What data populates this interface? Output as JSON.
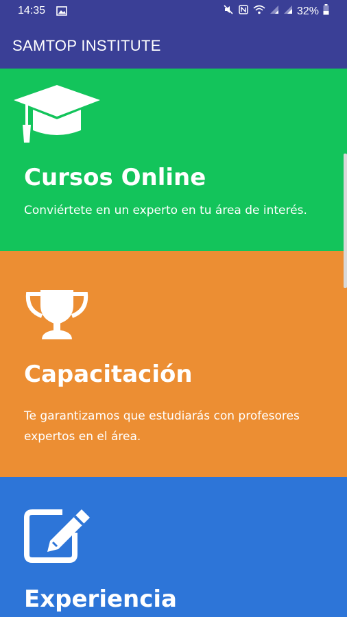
{
  "status_bar": {
    "time": "14:35",
    "battery": "32%",
    "icons": [
      "image-icon",
      "mute-icon",
      "nfc-icon",
      "wifi-icon",
      "signal-icon",
      "signal-icon",
      "battery-icon"
    ]
  },
  "app_bar": {
    "title": "SAMTOP INSTITUTE"
  },
  "cards": [
    {
      "title": "Cursos Online",
      "description": "Conviértete en un experto en tu área de interés.",
      "icon": "graduation-cap-icon",
      "color": "#13c45b"
    },
    {
      "title": "Capacitación",
      "description": "Te garantizamos que estudiarás con profesores expertos en el área.",
      "icon": "trophy-icon",
      "color": "#ec8e33"
    },
    {
      "title": "Experiencia",
      "description": "",
      "icon": "edit-icon",
      "color": "#2d75d8"
    }
  ],
  "colors": {
    "primary": "#3a3f96"
  }
}
